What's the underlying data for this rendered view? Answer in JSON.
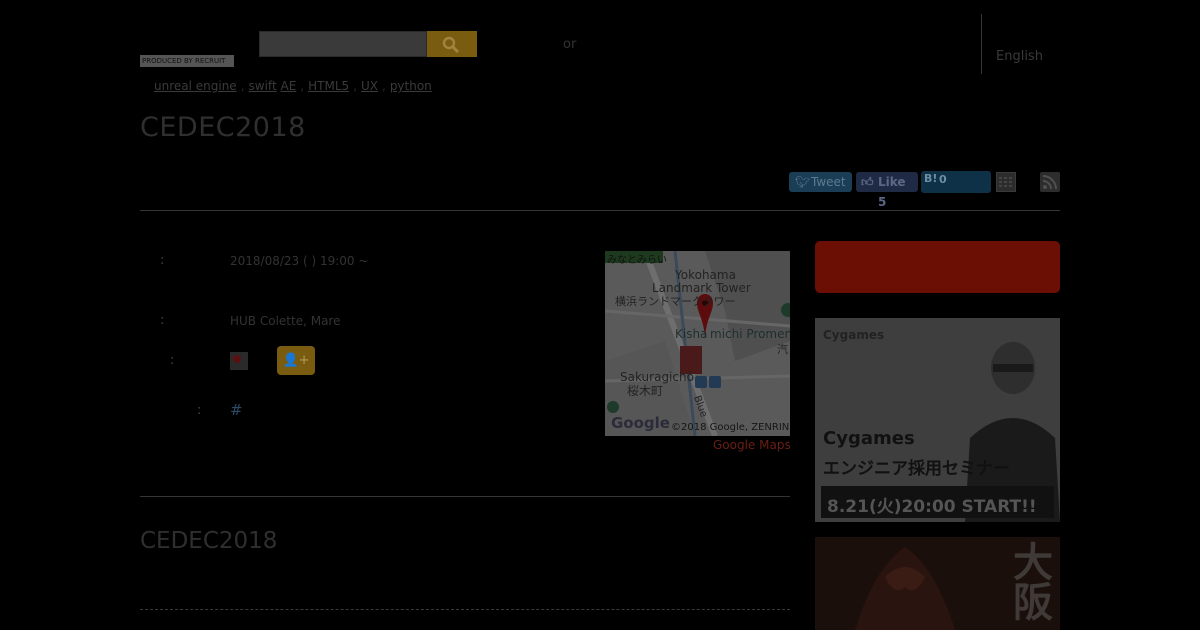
{
  "header": {
    "logo_text": "PRODUCED BY RECRUIT",
    "search_placeholder": "",
    "or_text": "or",
    "language_link": "English"
  },
  "tags": [
    "unreal engine",
    "swift",
    "AE",
    "HTML5",
    "UX",
    "python"
  ],
  "event": {
    "title": "CEDEC2018",
    "date_label": ":",
    "date_value": "2018/08/23 (  ) 19:00 ~",
    "place_label": ":",
    "place_value": "HUB Colette, Mare",
    "participants_label": ":",
    "hashtag_label": ":",
    "hashtag_value": "#"
  },
  "social": {
    "tweet_label": "Tweet",
    "like_label": "Like 5",
    "hatena_icon": "B!",
    "hatena_count": "0"
  },
  "map": {
    "labels": [
      "みなとみらい",
      "Yokohama",
      "Landmark Tower",
      "横浜ランドマークタワー",
      "Kisha",
      "michi Promena",
      "Sakuragichō",
      "桜木町",
      "Blue",
      "汽"
    ],
    "attribution": "©2018 Google, ZENRIN",
    "google_text": "Google",
    "link_text": "Google Maps"
  },
  "section": {
    "title": "CEDEC2018"
  },
  "ads": {
    "cygames_brand": "Cygames",
    "cygames_line1": "Cygames",
    "cygames_line2": "エンジニア採用セミナー",
    "cygames_line3": "8.21(火)20:00 START!!",
    "ad2_kanji": "大阪"
  },
  "colors": {
    "background": "#000000",
    "accent_orange": "#7a5c10",
    "accent_red": "#6b0e04",
    "map_link": "#6b1e14"
  }
}
